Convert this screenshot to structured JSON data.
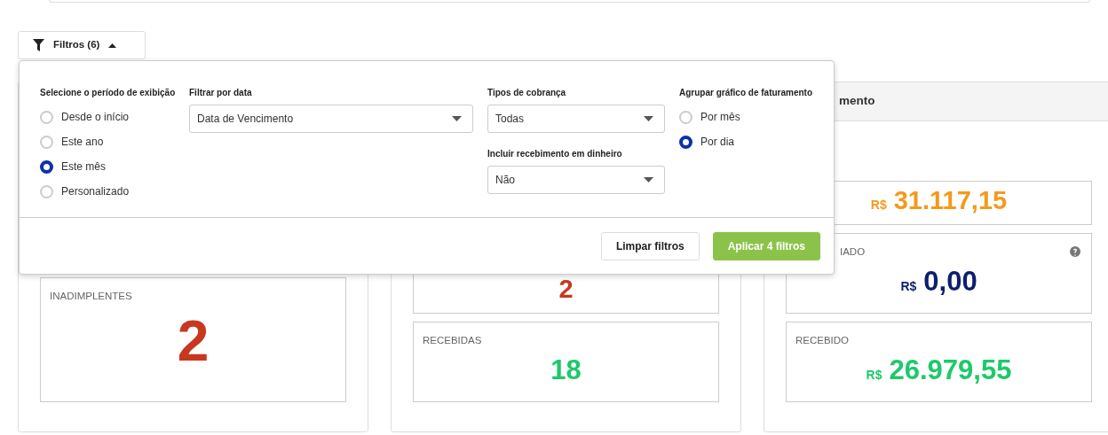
{
  "filter_button": {
    "label": "Filtros (6)",
    "expanded": true
  },
  "filter_panel": {
    "period": {
      "label": "Selecione o período de exibição",
      "options": [
        {
          "label": "Desde o início",
          "selected": false
        },
        {
          "label": "Este ano",
          "selected": false
        },
        {
          "label": "Este mês",
          "selected": true
        },
        {
          "label": "Personalizado",
          "selected": false
        }
      ]
    },
    "date_filter": {
      "label": "Filtrar por data",
      "value": "Data de Vencimento"
    },
    "billing_types": {
      "label": "Tipos de cobrança",
      "value": "Todas"
    },
    "cash_receipts": {
      "label": "Incluir recebimento em dinheiro",
      "value": "Não"
    },
    "grouping": {
      "label": "Agrupar gráfico de faturamento",
      "options": [
        {
          "label": "Por mês",
          "selected": false
        },
        {
          "label": "Por dia",
          "selected": true
        }
      ]
    },
    "buttons": [
      {
        "label": "Limpar filtros",
        "kind": "secondary"
      },
      {
        "label": "Aplicar 4 filtros",
        "kind": "primary"
      }
    ]
  },
  "dashboard": {
    "cards": [
      {
        "boxes": [
          {
            "label": "INADIMPLENTES",
            "value": "2",
            "color": "#c8381f"
          }
        ]
      },
      {
        "boxes": [
          {
            "value": "2",
            "color": "#c8381f"
          },
          {
            "label": "RECEBIDAS",
            "value": "18",
            "color": "#1ec96b"
          }
        ]
      },
      {
        "header": "mento",
        "boxes": [
          {
            "currency": "R$",
            "value": "31.117,15",
            "color": "#f39a1c"
          },
          {
            "label": "IADO",
            "currency": "R$",
            "value": "0,00",
            "color": "#0d1e6e",
            "help_icon": true
          },
          {
            "label": "RECEBIDO",
            "currency": "R$",
            "value": "26.979,55",
            "color": "#1ec96b"
          }
        ]
      }
    ]
  }
}
